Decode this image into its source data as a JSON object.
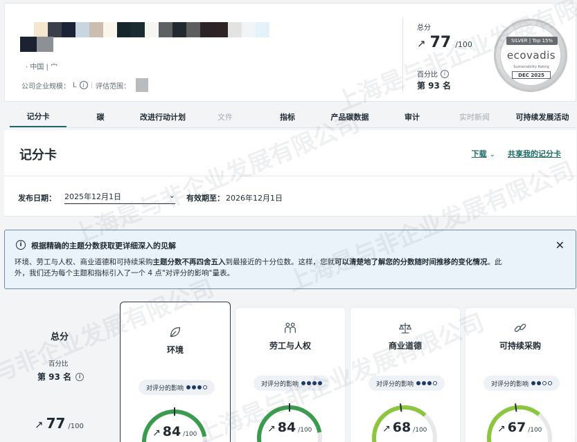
{
  "company": {
    "location": "· 中国 |",
    "location_extra": "宀",
    "size_label": "公司企业规模：",
    "size_value": "L",
    "scope_label": "评估范围："
  },
  "header_score": {
    "total_label": "总分",
    "arrow": "↗",
    "score": "77",
    "denominator": "/100",
    "percentile_label": "百分比",
    "rank": "第 93 名"
  },
  "medal": {
    "tier": "SILVER | Top 15%",
    "brand": "ecovadis",
    "rating_text": "Sustainability Rating",
    "date": "DEC 2025"
  },
  "tabs": [
    {
      "label": "记分卡",
      "state": "active"
    },
    {
      "label": "碳",
      "state": "normal"
    },
    {
      "label": "改进行动计划",
      "state": "normal"
    },
    {
      "label": "文件",
      "state": "disabled"
    },
    {
      "label": "指标",
      "state": "normal"
    },
    {
      "label": "产品碳数据",
      "state": "normal"
    },
    {
      "label": "审计",
      "state": "normal"
    },
    {
      "label": "实时新闻",
      "state": "disabled"
    },
    {
      "label": "可持续发展活动",
      "state": "normal"
    }
  ],
  "scorecard": {
    "title": "记分卡",
    "download": "下载",
    "share": "共享我的记分卡",
    "publish_label": "发布日期：",
    "publish_date": "2025年12月1日",
    "valid_label": "有效期至：",
    "valid_date": "2026年12月1日"
  },
  "banner": {
    "title": "根据精确的主题分数获取更详细深入的见解",
    "body_1": "环境、劳工与人权、商业道德和可持续采购",
    "body_2": "主题分数不再四舍五入",
    "body_3": "到最接近的十分位数。这样，您就",
    "body_4": "可以清楚地了解您的分数随时间推移的变化情况",
    "body_5": "。此外，我们还为每个主题和指标引入了一个 4 点\"对评分的影响\"量表。",
    "close": "✕"
  },
  "summary": {
    "title": "总分",
    "percentile_label": "百分比",
    "rank": "第 93 名",
    "arrow": "↗",
    "score": "77",
    "denominator": "/100"
  },
  "themes": [
    {
      "name": "环境",
      "icon": "leaf-icon",
      "impact_label": "对评分的影响",
      "impact_level": 3,
      "score": 84,
      "arrow": "↗",
      "denominator": "/100",
      "color": "#3a9a4e",
      "active": true
    },
    {
      "name": "劳工与人权",
      "icon": "people-icon",
      "impact_label": "对评分的影响",
      "impact_level": 4,
      "score": 84,
      "arrow": "↗",
      "denominator": "/100",
      "color": "#3a9a4e",
      "active": false
    },
    {
      "name": "商业道德",
      "icon": "scales-icon",
      "impact_label": "对评分的影响",
      "impact_level": 3,
      "score": 68,
      "arrow": "↗",
      "denominator": "/100",
      "color": "#8cc63f",
      "active": false
    },
    {
      "name": "可持续采购",
      "icon": "chain-icon",
      "impact_label": "对评分的影响",
      "impact_level": 2,
      "score": 67,
      "arrow": "↗",
      "denominator": "/100",
      "color": "#8cc63f",
      "active": false
    }
  ],
  "watermark": "上海是与非企业发展有限公司"
}
